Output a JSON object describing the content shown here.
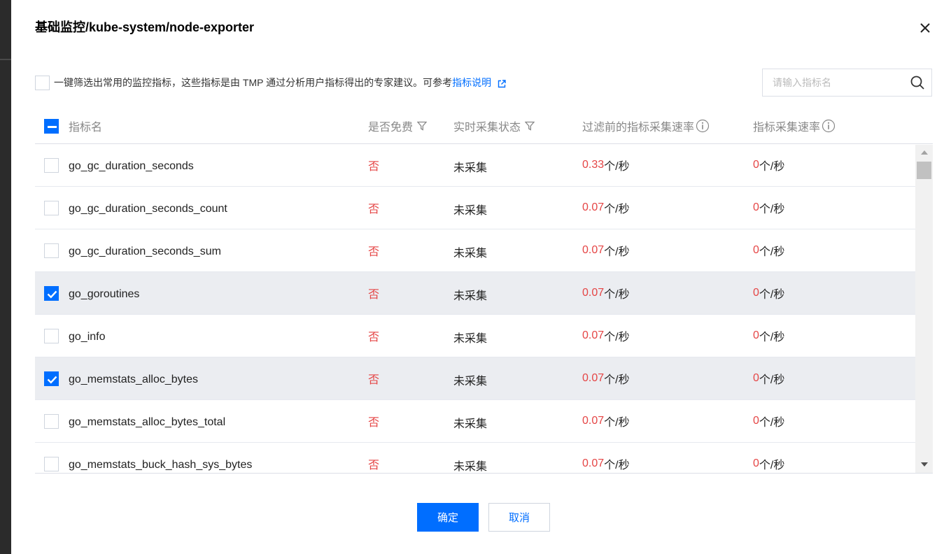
{
  "dialog": {
    "title": "基础监控/kube-system/node-exporter",
    "close_icon": "close-icon"
  },
  "filter": {
    "text": "一键筛选出常用的监控指标，这些指标是由 TMP 通过分析用户指标得出的专家建议。可参考",
    "link_label": "指标说明",
    "link_icon": "external-link-icon",
    "checked": false
  },
  "search": {
    "placeholder": "请输入指标名",
    "value": "",
    "icon": "search-icon"
  },
  "table": {
    "columns": {
      "name": "指标名",
      "free": "是否免费",
      "status": "实时采集状态",
      "rate_before": "过滤前的指标采集速率",
      "rate": "指标采集速率"
    },
    "unit": "个/秒",
    "rows": [
      {
        "name": "go_gc_duration_seconds",
        "free": "否",
        "status": "未采集",
        "rate_before": "0.33",
        "rate": "0",
        "checked": false
      },
      {
        "name": "go_gc_duration_seconds_count",
        "free": "否",
        "status": "未采集",
        "rate_before": "0.07",
        "rate": "0",
        "checked": false
      },
      {
        "name": "go_gc_duration_seconds_sum",
        "free": "否",
        "status": "未采集",
        "rate_before": "0.07",
        "rate": "0",
        "checked": false
      },
      {
        "name": "go_goroutines",
        "free": "否",
        "status": "未采集",
        "rate_before": "0.07",
        "rate": "0",
        "checked": true
      },
      {
        "name": "go_info",
        "free": "否",
        "status": "未采集",
        "rate_before": "0.07",
        "rate": "0",
        "checked": false
      },
      {
        "name": "go_memstats_alloc_bytes",
        "free": "否",
        "status": "未采集",
        "rate_before": "0.07",
        "rate": "0",
        "checked": true
      },
      {
        "name": "go_memstats_alloc_bytes_total",
        "free": "否",
        "status": "未采集",
        "rate_before": "0.07",
        "rate": "0",
        "checked": false
      },
      {
        "name": "go_memstats_buck_hash_sys_bytes",
        "free": "否",
        "status": "未采集",
        "rate_before": "0.07",
        "rate": "0",
        "checked": false
      }
    ]
  },
  "footer": {
    "confirm_label": "确定",
    "cancel_label": "取消"
  },
  "colors": {
    "accent": "#006eff",
    "negative": "#e54545",
    "selected_row": "#ebedf1"
  }
}
